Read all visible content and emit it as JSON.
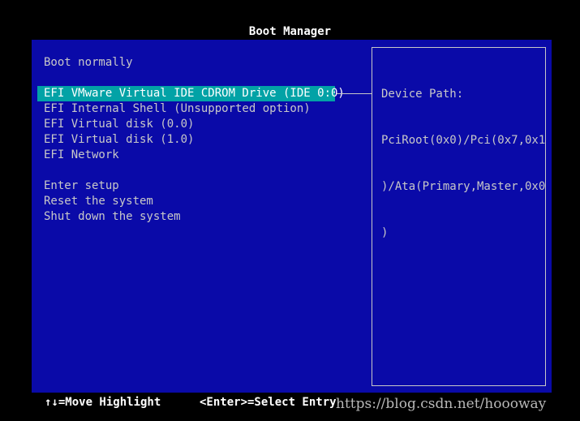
{
  "title": "Boot Manager",
  "menu": {
    "items": [
      {
        "label": "Boot normally"
      },
      {
        "label": ""
      },
      {
        "label": "EFI VMware Virtual IDE CDROM Drive (IDE 0:0)",
        "selected": true
      },
      {
        "label": "EFI Internal Shell (Unsupported option)"
      },
      {
        "label": "EFI Virtual disk (0.0)"
      },
      {
        "label": "EFI Virtual disk (1.0)"
      },
      {
        "label": "EFI Network"
      },
      {
        "label": ""
      },
      {
        "label": "Enter setup"
      },
      {
        "label": "Reset the system"
      },
      {
        "label": "Shut down the system"
      }
    ]
  },
  "info": {
    "lines": [
      "Device Path:",
      "PciRoot(0x0)/Pci(0x7,0x1",
      ")/Ata(Primary,Master,0x0",
      ")"
    ]
  },
  "footer": {
    "move_hint": "↑↓=Move Highlight",
    "select_hint": "<Enter>=Select Entry",
    "watermark": "https://blog.csdn.net/hoooway"
  },
  "colors": {
    "panel_bg": "#0a0aa8",
    "selected_bg": "#02a2a6",
    "text": "#c8c8c8",
    "highlight_text": "#ffffff"
  }
}
